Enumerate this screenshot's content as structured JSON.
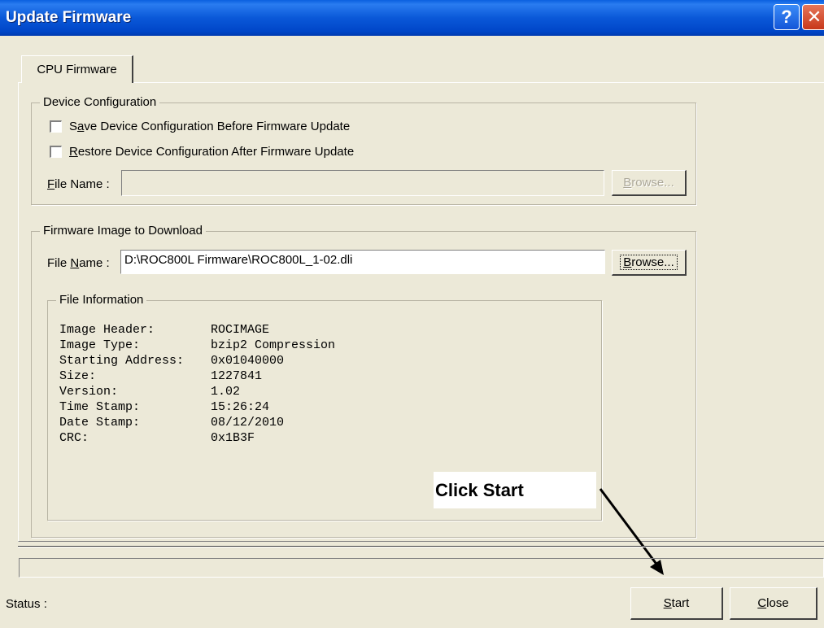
{
  "window": {
    "title": "Update Firmware",
    "help_glyph": "?",
    "close_glyph": "✕"
  },
  "tab": {
    "label": "CPU Firmware"
  },
  "device_config": {
    "legend": "Device Configuration",
    "save_checkbox": {
      "pre": "S",
      "accel": "a",
      "post": "ve Device Configuration Before Firmware Update",
      "checked": false
    },
    "restore_checkbox": {
      "pre": "",
      "accel": "R",
      "post": "estore Device Configuration After Firmware Update",
      "checked": false
    },
    "file_label": {
      "pre": "",
      "accel": "F",
      "post": "ile Name :"
    },
    "file_value": "",
    "browse": {
      "pre": "",
      "accel": "B",
      "post": "rowse...",
      "enabled": false
    }
  },
  "firmware_image": {
    "legend": "Firmware Image to Download",
    "file_label": {
      "pre": "File ",
      "accel": "N",
      "post": "ame :"
    },
    "file_value": "D:\\ROC800L Firmware\\ROC800L_1-02.dli",
    "browse": {
      "pre": "",
      "accel": "B",
      "post": "rowse...",
      "enabled": true
    }
  },
  "file_info": {
    "legend": "File Information",
    "rows": [
      {
        "key": "Image Header:",
        "value": "ROCIMAGE"
      },
      {
        "key": "Image Type:",
        "value": "bzip2 Compression"
      },
      {
        "key": "Starting Address:",
        "value": "0x01040000"
      },
      {
        "key": "Size:",
        "value": "1227841"
      },
      {
        "key": "Version:",
        "value": "1.02"
      },
      {
        "key": "Time Stamp:",
        "value": "15:26:24"
      },
      {
        "key": "Date Stamp:",
        "value": "08/12/2010"
      },
      {
        "key": "CRC:",
        "value": "0x1B3F"
      }
    ]
  },
  "annotation": {
    "text": "Click Start"
  },
  "footer": {
    "status_label": "Status :",
    "status_value": "",
    "start": {
      "pre": "",
      "accel": "S",
      "post": "tart"
    },
    "close": {
      "pre": "",
      "accel": "C",
      "post": "lose"
    }
  },
  "colors": {
    "titlebar": "#0a58d8",
    "dialog": "#ece9d8",
    "close_button": "#c8381a"
  }
}
